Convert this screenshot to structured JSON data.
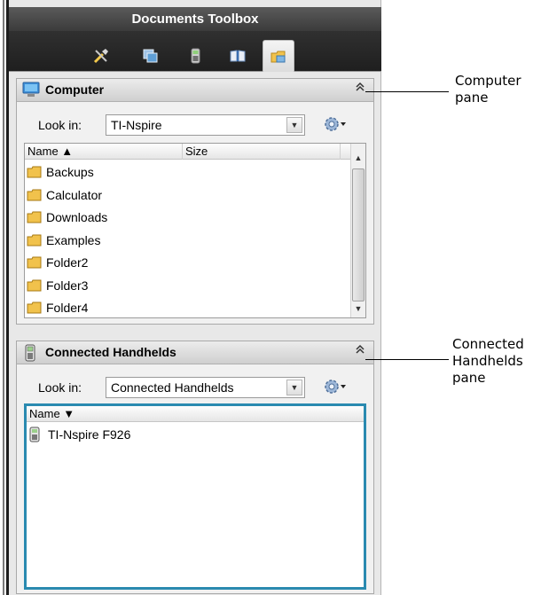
{
  "toolbox": {
    "title": "Documents Toolbox",
    "tabs": [
      "document-tools-icon",
      "page-sorter-icon",
      "handheld-emulator-icon",
      "content-explorer-icon",
      "content-explorer-active-icon"
    ]
  },
  "computer_pane": {
    "title": "Computer",
    "collapse_glyph": "≈",
    "lookin_label": "Look in:",
    "lookin_value": "TI-Nspire",
    "columns": {
      "name": "Name ▲",
      "size": "Size"
    },
    "items": [
      "Backups",
      "Calculator",
      "Downloads",
      "Examples",
      "Folder2",
      "Folder3",
      "Folder4"
    ]
  },
  "handhelds_pane": {
    "title": "Connected Handhelds",
    "collapse_glyph": "≈",
    "lookin_label": "Look in:",
    "lookin_value": "Connected Handhelds",
    "columns": {
      "name": "Name ▼"
    },
    "items": [
      "TI-Nspire F926"
    ]
  },
  "callouts": {
    "computer": [
      "Computer",
      "pane"
    ],
    "handhelds": [
      "Connected",
      "Handhelds",
      "pane"
    ]
  },
  "colors": {
    "header_dark": "#3b3b3b",
    "focus_border": "#2a8ab0",
    "folder": "#f1c24c"
  }
}
